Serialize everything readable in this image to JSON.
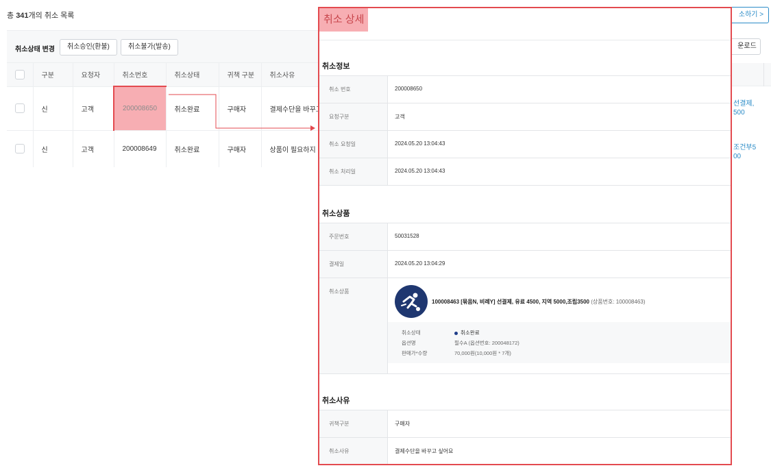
{
  "list": {
    "total_prefix": "총 ",
    "total_count": "341",
    "total_suffix": "개의 취소 목록",
    "toolbar": {
      "label": "취소상태 변경",
      "approve_refund": "취소승인(환불)",
      "reject_ship": "취소불가(발송)"
    },
    "columns": [
      "구분",
      "요청자",
      "취소번호",
      "취소상태",
      "귀책 구분",
      "취소사유"
    ],
    "rows": [
      {
        "type": "신",
        "requester": "고객",
        "cancel_no": "200008650",
        "status": "취소완료",
        "fault": "구매자",
        "reason": "결제수단을 바꾸고 싶어요"
      },
      {
        "type": "신",
        "requester": "고객",
        "cancel_no": "200008649",
        "status": "취소완료",
        "fault": "구매자",
        "reason": "상품이 필요하지 않아요"
      }
    ],
    "peek": {
      "btn1": "소하기 >",
      "btn2": "운로드",
      "row1_line1": "선결제,",
      "row1_line2": "500",
      "row2_line1": "조건부5",
      "row2_line2": "00"
    }
  },
  "panel": {
    "title": "취소 상세",
    "cancel_info": {
      "section_title": "취소정보",
      "rows": [
        {
          "label": "취소 번호",
          "value": "200008650"
        },
        {
          "label": "요청구분",
          "value": "고객"
        },
        {
          "label": "취소 요청일",
          "value": "2024.05.20 13:04:43"
        },
        {
          "label": "취소 처리일",
          "value": "2024.05.20 13:04:43"
        }
      ]
    },
    "cancel_product": {
      "section_title": "취소상품",
      "rows": [
        {
          "label": "주문번호",
          "value": "50031528"
        },
        {
          "label": "결제일",
          "value": "2024.05.20 13:04:29"
        }
      ],
      "product_label": "취소상품",
      "product_name": "100008463 [묶음N, 비례Y] 선결제, 유료 4500, 지역 5000,조립3500",
      "product_code": " (상품번호: 100008463)",
      "details": {
        "status_label": "취소상태",
        "status_value": "취소완료",
        "option_label": "옵션명",
        "option_value": "필수A (옵션번호: 200048172)",
        "price_label": "판매가*수량",
        "price_value": "70,000원(10,000원 * 7개)"
      }
    },
    "cancel_reason": {
      "section_title": "취소사유",
      "rows": [
        {
          "label": "귀책구분",
          "value": "구매자"
        },
        {
          "label": "취소사유",
          "value": "결제수단을 바꾸고 싶어요"
        }
      ]
    }
  },
  "colors": {
    "highlight_fill": "#f7aeb3",
    "highlight_border": "#e34a4f",
    "link": "#2a8bc7",
    "logo_bg": "#1f3770"
  },
  "icons": [
    "checkbox-icon",
    "product-logo-icon",
    "status-dot-icon",
    "arrow-connector-icon"
  ]
}
